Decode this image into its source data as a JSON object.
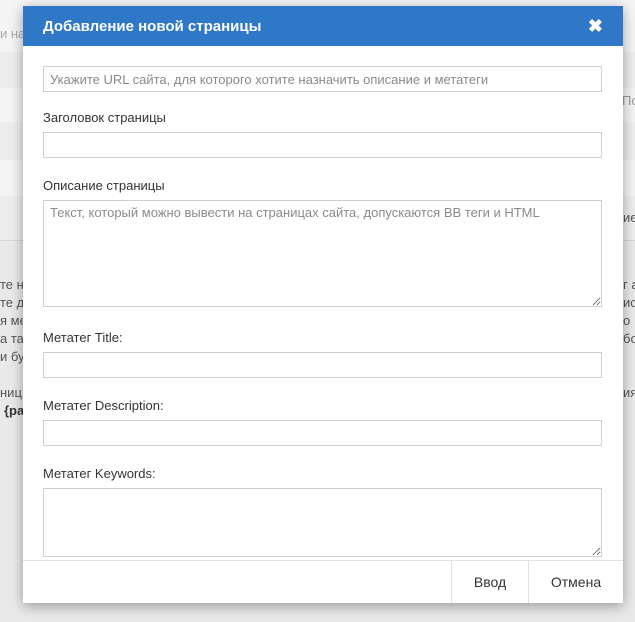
{
  "background": {
    "search_fragment": "и на",
    "right_fragment_1": "По",
    "right_fragment_2": "ие",
    "left_lines": [
      "те н",
      "те д",
      "я ме",
      "а та",
      "и бу",
      "ниц",
      "{ра"
    ],
    "right_lines": [
      "г а",
      "ис",
      "о",
      "бо",
      "ия"
    ]
  },
  "modal": {
    "title": "Добавление новой страницы",
    "close_icon": "close-icon",
    "url_placeholder": "Укажите URL сайта, для которого хотите назначить описание и метатеги",
    "page_title_label": "Заголовок страницы",
    "page_title_value": "",
    "description_label": "Описание страницы",
    "description_placeholder": "Текст, который можно вывести на страницах сайта, допускаются BB теги и HTML",
    "meta_title_label": "Метатег Title:",
    "meta_description_label": "Метатег Description:",
    "meta_keywords_label": "Метатег Keywords:",
    "submit_label": "Ввод",
    "cancel_label": "Отмена"
  },
  "colors": {
    "header_bg": "#2f78c7",
    "header_text": "#ffffff"
  }
}
